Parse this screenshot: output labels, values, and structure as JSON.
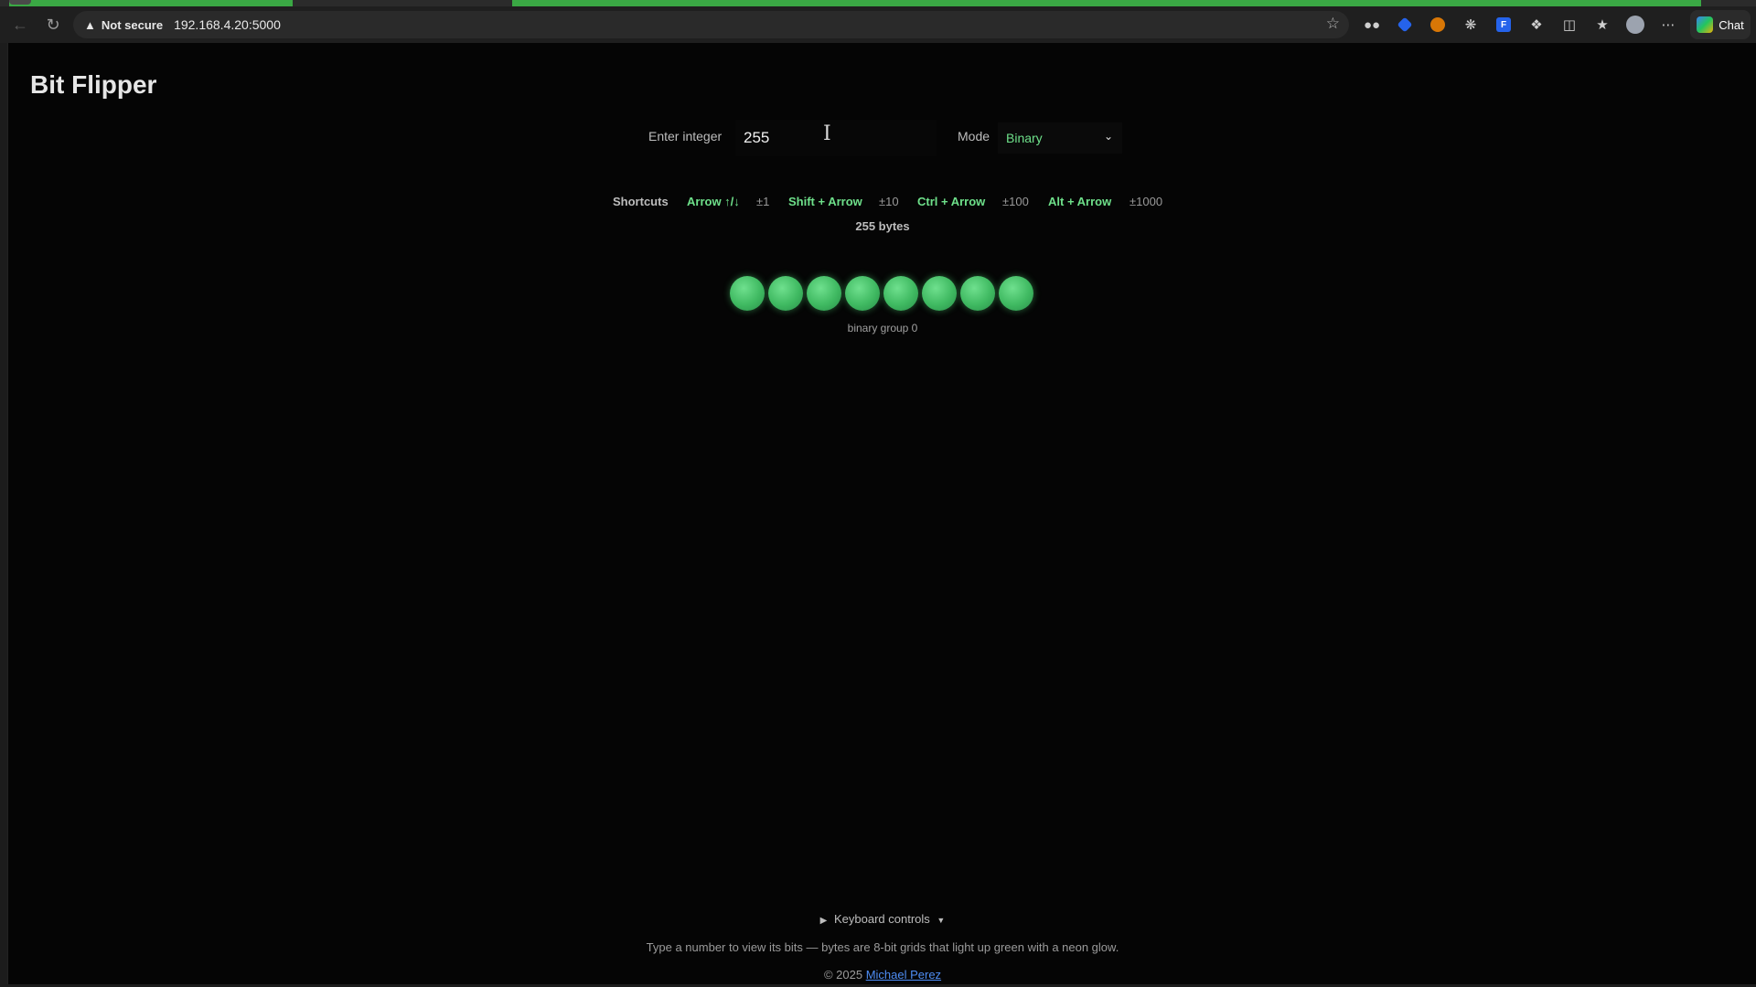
{
  "browser": {
    "security_label": "Not secure",
    "url": "192.168.4.20:5000",
    "chat_label": "Chat"
  },
  "app": {
    "title": "Bit Flipper",
    "integer_label": "Enter integer",
    "integer_value": "255",
    "mode_label": "Mode",
    "mode_value": "Binary",
    "shortcuts": {
      "label": "Shortcuts",
      "items": [
        {
          "key": "Arrow ↑/↓",
          "amount": "±1"
        },
        {
          "key": "Shift + Arrow",
          "amount": "±10"
        },
        {
          "key": "Ctrl + Arrow",
          "amount": "±100"
        },
        {
          "key": "Alt + Arrow",
          "amount": "±1000"
        }
      ]
    },
    "bytes_count": "255 bytes",
    "bits": [
      1,
      1,
      1,
      1,
      1,
      1,
      1,
      1
    ],
    "group_label": "binary group 0",
    "bit_on_color": "#3fb961"
  },
  "footer": {
    "toggle_label": "Keyboard controls",
    "description": "Type a number to view its bits — bytes are 8-bit grids that light up green with a neon glow.",
    "copyright": "© 2025",
    "author": "Michael Perez"
  },
  "colors": {
    "accent_green": "#6ee08a",
    "link_blue": "#4e8df5",
    "background": "#050505"
  }
}
